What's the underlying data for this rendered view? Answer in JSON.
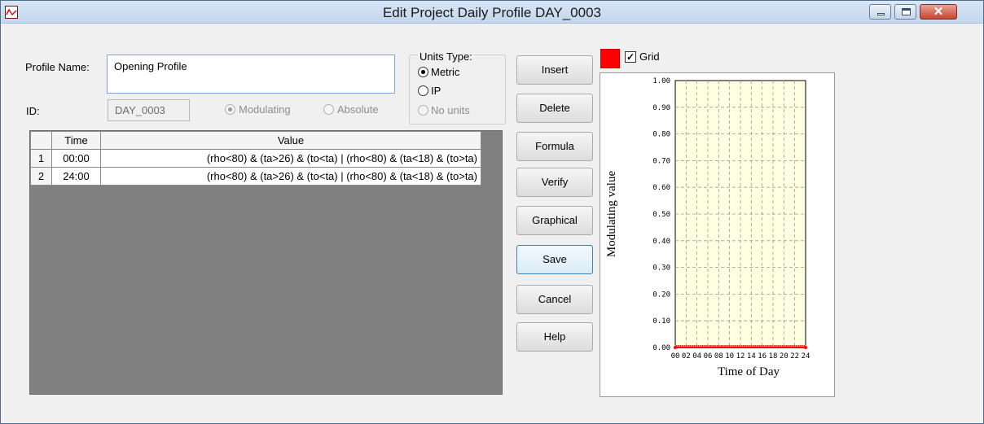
{
  "window": {
    "title": "Edit Project Daily Profile DAY_0003",
    "icon": "profile-chart-icon"
  },
  "profile": {
    "name_label": "Profile Name:",
    "name_value": "Opening Profile",
    "id_label": "ID:",
    "id_value": "DAY_0003",
    "mode_options": [
      {
        "label": "Modulating",
        "selected": true,
        "enabled": false
      },
      {
        "label": "Absolute",
        "selected": false,
        "enabled": false
      }
    ]
  },
  "units": {
    "title": "Units Type:",
    "options": [
      {
        "label": "Metric",
        "selected": true,
        "enabled": true
      },
      {
        "label": "IP",
        "selected": false,
        "enabled": true
      },
      {
        "label": "No units",
        "selected": false,
        "enabled": false
      }
    ]
  },
  "table": {
    "columns": [
      "Time",
      "Value"
    ],
    "rows": [
      {
        "num": "1",
        "time": "00:00",
        "value": "(rho<80) & (ta>26) & (to<ta) | (rho<80) & (ta<18) & (to>ta)"
      },
      {
        "num": "2",
        "time": "24:00",
        "value": "(rho<80) & (ta>26) & (to<ta) | (rho<80) & (ta<18) & (to>ta)"
      }
    ]
  },
  "buttons": {
    "insert": "Insert",
    "delete": "Delete",
    "formula": "Formula",
    "verify": "Verify",
    "graphical": "Graphical",
    "save": "Save",
    "cancel": "Cancel",
    "help": "Help"
  },
  "grid_toggle": {
    "label": "Grid",
    "checked": true
  },
  "colors": {
    "line_color": "#ff0000",
    "plot_background": "#ffffe1",
    "gridline": "#9a9a9a",
    "accent": "#3c7fb1"
  },
  "chart_data": {
    "type": "line",
    "xlabel": "Time of Day",
    "ylabel": "Modulating value",
    "xlim": [
      0,
      24
    ],
    "ylim": [
      0,
      1
    ],
    "xticks": [
      "00",
      "02",
      "04",
      "06",
      "08",
      "10",
      "12",
      "14",
      "16",
      "18",
      "20",
      "22",
      "24"
    ],
    "yticks": [
      "0.00",
      "0.10",
      "0.20",
      "0.30",
      "0.40",
      "0.50",
      "0.60",
      "0.70",
      "0.80",
      "0.90",
      "1.00"
    ],
    "grid": true,
    "series": [
      {
        "x": [
          0,
          24
        ],
        "y": [
          0,
          0
        ]
      }
    ]
  }
}
